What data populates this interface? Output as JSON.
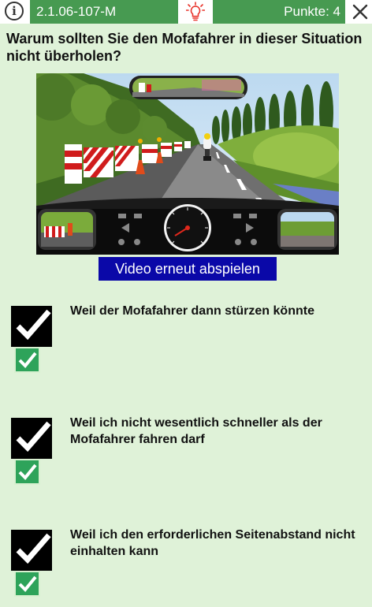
{
  "header": {
    "question_code": "2.1.06-107-M",
    "points_label": "Punkte: 4",
    "info_icon": "info-icon",
    "hint_icon": "lightbulb-icon",
    "close_icon": "close-icon",
    "accent_color": "#479a51"
  },
  "question": {
    "text": "Warum sollten Sie den Mofafahrer in dieser Situation nicht überholen?"
  },
  "video": {
    "replay_label": "Video erneut abspielen",
    "button_color": "#0a08a8"
  },
  "answers": [
    {
      "text": "Weil der Mofafahrer dann stürzen könnte",
      "user_checked": true,
      "correct": true
    },
    {
      "text": "Weil ich nicht wesentlich schneller als der Mofafahrer fahren darf",
      "user_checked": true,
      "correct": true
    },
    {
      "text": "Weil ich den erforderlichen Seitenabstand nicht einhalten kann",
      "user_checked": true,
      "correct": true
    }
  ]
}
